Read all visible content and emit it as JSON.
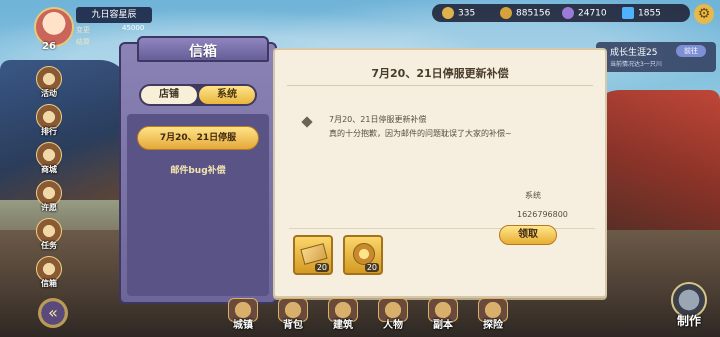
{
  "profile": {
    "level": "26",
    "name": "九日容星辰",
    "row1": "变更",
    "gold_mini": "45000",
    "row2": "结算"
  },
  "resources": [
    {
      "value": "335",
      "icon": "gold-coin-icon",
      "color": "#e0b24a"
    },
    {
      "value": "885156",
      "icon": "coin-stack-icon",
      "color": "#d6a23b"
    },
    {
      "value": "24710",
      "icon": "purple-orb-icon",
      "color": "#9b7ad8"
    },
    {
      "value": "1855",
      "icon": "diamond-icon",
      "color": "#4fb2ff"
    }
  ],
  "growth": {
    "title": "成长生涯25",
    "button": "前往",
    "subtitle": "当前情况达3一只川"
  },
  "sidebar": [
    {
      "label": "活动"
    },
    {
      "label": "排行"
    },
    {
      "label": "商城"
    },
    {
      "label": "许愿"
    },
    {
      "label": "任务"
    },
    {
      "label": "信箱"
    }
  ],
  "mail": {
    "title": "信箱",
    "tabs": {
      "shop": "店铺",
      "system": "系统"
    },
    "selected_item": "7月20、21日停服",
    "other_item": "邮件bug补偿",
    "subject": "7月20、21日停服更新补偿",
    "body_line1": "7月20、21日停服更新补偿",
    "body_line2": "真的十分抱歉，因为邮件的问题耽误了大家的补偿~",
    "sender": "系统",
    "timestamp": "1626796800",
    "attachments": [
      {
        "icon": "ticket-icon",
        "qty": "20"
      },
      {
        "icon": "badge-icon",
        "qty": "20"
      }
    ],
    "claim": "领取"
  },
  "bottom_nav": [
    {
      "label": "城镇"
    },
    {
      "label": "背包"
    },
    {
      "label": "建筑"
    },
    {
      "label": "人物"
    },
    {
      "label": "副本"
    },
    {
      "label": "探险"
    }
  ],
  "craft": {
    "label": "制作"
  }
}
